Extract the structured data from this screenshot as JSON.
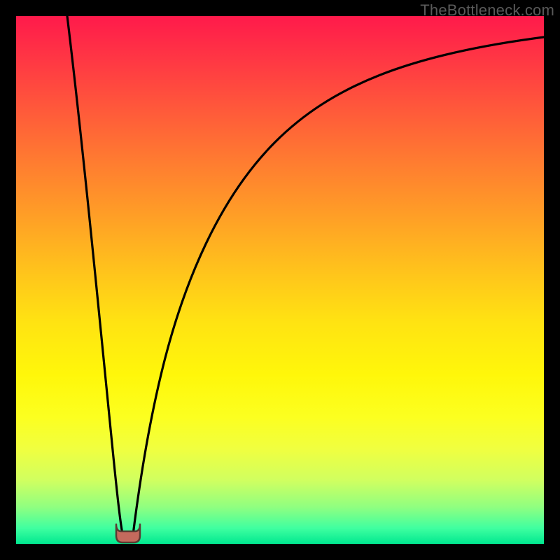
{
  "attribution": "TheBottleneck.com",
  "colors": {
    "background": "#000000",
    "gradient_top": "#ff1a4b",
    "gradient_bottom": "#00e890",
    "curve_stroke": "#000000",
    "marker_fill": "#c46a5d",
    "marker_stroke": "#3a2a24"
  },
  "chart_data": {
    "type": "line",
    "title": "",
    "xlabel": "",
    "ylabel": "",
    "xlim": [
      0,
      100
    ],
    "ylim": [
      0,
      100
    ],
    "x": [
      0,
      2,
      4,
      6,
      8,
      10,
      12,
      14,
      16,
      18,
      20,
      22,
      24,
      26,
      28,
      30,
      32,
      34,
      36,
      38,
      40,
      42,
      44,
      46,
      48,
      50,
      55,
      60,
      65,
      70,
      75,
      80,
      85,
      90,
      95,
      100
    ],
    "series": [
      {
        "name": "left-branch",
        "values": [
          100,
          90,
          80,
          70,
          60,
          50,
          40,
          30,
          20,
          10,
          0,
          null,
          null,
          null,
          null,
          null,
          null,
          null,
          null,
          null,
          null,
          null,
          null,
          null,
          null,
          null,
          null,
          null,
          null,
          null,
          null,
          null,
          null,
          null,
          null,
          null
        ]
      },
      {
        "name": "right-branch",
        "values": [
          null,
          null,
          null,
          null,
          null,
          null,
          null,
          null,
          null,
          null,
          0,
          12,
          23,
          32,
          40,
          47,
          53,
          58,
          62.5,
          66.5,
          70,
          73,
          75.5,
          77.8,
          79.8,
          81.5,
          85,
          87.7,
          89.8,
          91.5,
          92.8,
          93.8,
          94.6,
          95.2,
          95.7,
          96
        ]
      }
    ],
    "marker": {
      "x_range": [
        18.5,
        21.5
      ],
      "y": 2.5
    },
    "note": "Values are read from pixel geometry; axes have no tick labels so x/y are normalized 0-100 spanning the plot area."
  }
}
